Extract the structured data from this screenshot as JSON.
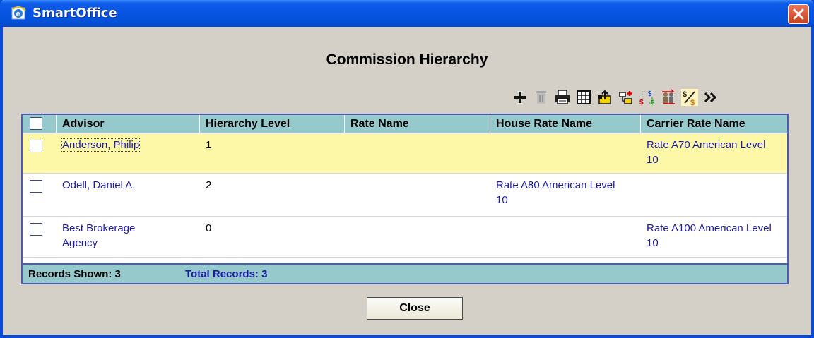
{
  "window": {
    "title": "SmartOffice"
  },
  "dialog": {
    "title": "Commission Hierarchy"
  },
  "toolbar": {
    "icons": [
      "add-icon",
      "delete-icon",
      "print-icon",
      "grid-columns-icon",
      "export-icon",
      "add-hierarchy-icon",
      "rate-transfer-icon",
      "advisor-transfer-icon",
      "commission-rate-icon",
      "more-icon"
    ]
  },
  "table": {
    "headers": [
      "Advisor",
      "Hierarchy Level",
      "Rate Name",
      "House Rate Name",
      "Carrier Rate Name"
    ],
    "rows": [
      {
        "advisor": "Anderson, Philip",
        "level": "1",
        "rate": "",
        "house": "",
        "carrier": "Rate A70 American Level 10",
        "selected": true
      },
      {
        "advisor": "Odell, Daniel A.",
        "level": "2",
        "rate": "",
        "house": "Rate A80 American Level 10",
        "carrier": "",
        "selected": false
      },
      {
        "advisor": "Best Brokerage Agency",
        "level": "0",
        "rate": "",
        "house": "",
        "carrier": "Rate A100 American Level 10",
        "selected": false
      }
    ],
    "records_shown": "Records Shown: 3",
    "total_records": "Total Records: 3"
  },
  "buttons": {
    "close": "Close"
  },
  "colors": {
    "header_bg": "#96c9cc",
    "selected_row": "#fdf8a8",
    "link": "#1c1aa6",
    "border": "#4f5bb0"
  }
}
